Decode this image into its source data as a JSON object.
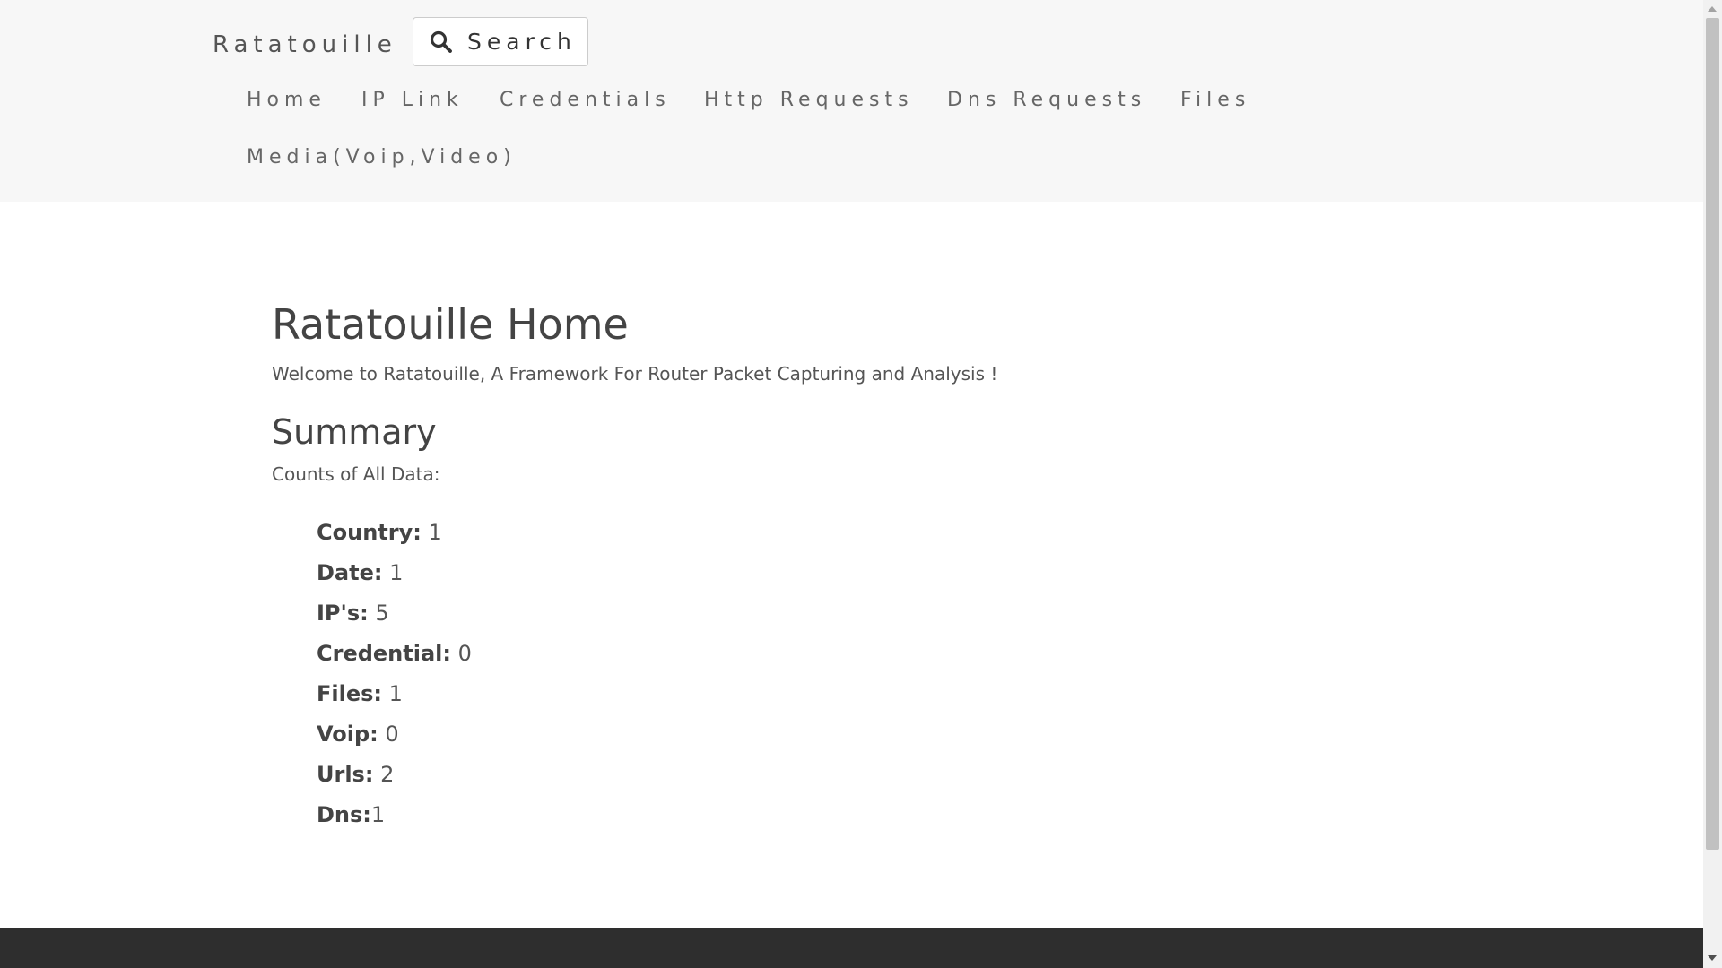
{
  "navbar": {
    "brand": "Ratatouille",
    "search_label": "Search",
    "links": [
      {
        "label": "Home"
      },
      {
        "label": "IP Link"
      },
      {
        "label": "Credentials"
      },
      {
        "label": "Http Requests"
      },
      {
        "label": "Dns Requests"
      },
      {
        "label": "Files"
      },
      {
        "label": "Media(Voip,Video)"
      }
    ]
  },
  "main": {
    "title": "Ratatouille Home",
    "intro": "Welcome to Ratatouille, A Framework For Router Packet Capturing and Analysis !",
    "summary_heading": "Summary",
    "summary_subtitle": "Counts of All Data:",
    "counts": [
      {
        "key": "Country:",
        "value": " 1"
      },
      {
        "key": "Date:",
        "value": " 1"
      },
      {
        "key": "IP's:",
        "value": " 5"
      },
      {
        "key": "Credential:",
        "value": " 0"
      },
      {
        "key": "Files:",
        "value": " 1"
      },
      {
        "key": "Voip:",
        "value": " 0"
      },
      {
        "key": "Urls:",
        "value": " 2"
      },
      {
        "key": "Dns:",
        "value": "1"
      }
    ]
  },
  "colors": {
    "navbar_bg": "#f7f7f7",
    "footer_bg": "#2e2e2e",
    "text": "#555555"
  }
}
